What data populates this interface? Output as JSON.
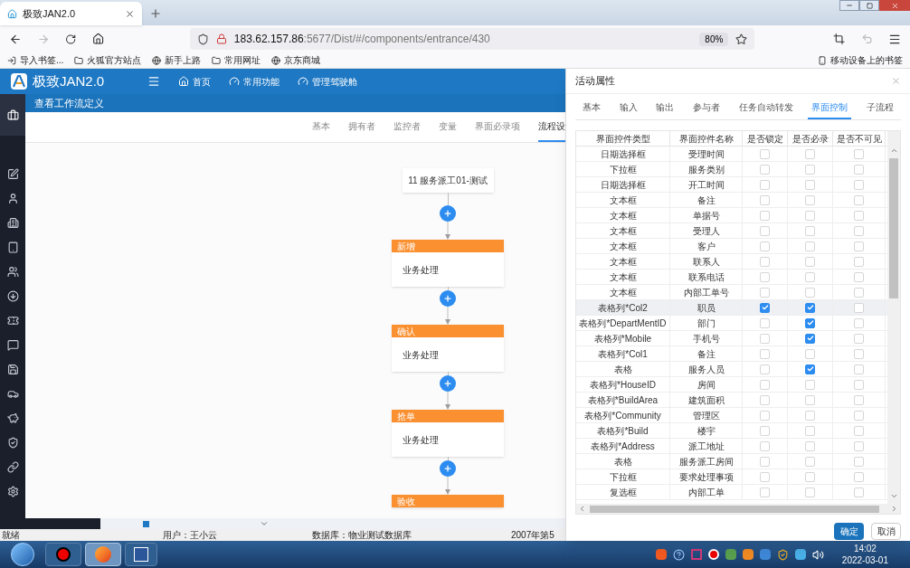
{
  "browser": {
    "tab_title": "极致JAN2.0",
    "url_host": "183.62.157.86",
    "url_path": ":5677/Dist/#/components/entrance/430",
    "zoom": "80%",
    "bookmarks": [
      "导入书签...",
      "火狐官方站点",
      "新手上路",
      "常用网址",
      "京东商城"
    ],
    "mobile_bookmarks": "移动设备上的书签"
  },
  "app": {
    "logo_text": "极致JAN2.0",
    "nav": [
      "首页",
      "常用功能",
      "管理驾驶舱"
    ]
  },
  "dialog": {
    "title": "查看工作流定义",
    "tabs": [
      {
        "label": "基本",
        "selected": false
      },
      {
        "label": "拥有者",
        "selected": false
      },
      {
        "label": "监控者",
        "selected": false
      },
      {
        "label": "变量",
        "selected": false
      },
      {
        "label": "界面必录项",
        "selected": false
      },
      {
        "label": "流程设",
        "selected": true
      }
    ],
    "start_node": "11 服务派工01-测试",
    "steps": [
      {
        "title": "新增",
        "body": "业务处理"
      },
      {
        "title": "确认",
        "body": "业务处理"
      },
      {
        "title": "抢单",
        "body": "业务处理"
      },
      {
        "title": "验收"
      }
    ]
  },
  "panel": {
    "title": "活动属性",
    "tabs": [
      {
        "label": "基本",
        "selected": false
      },
      {
        "label": "输入",
        "selected": false
      },
      {
        "label": "输出",
        "selected": false
      },
      {
        "label": "参与者",
        "selected": false
      },
      {
        "label": "任务自动转发",
        "selected": false
      },
      {
        "label": "界面控制",
        "selected": true
      },
      {
        "label": "子流程",
        "selected": false
      }
    ],
    "columns": [
      "界面控件类型",
      "界面控件名称",
      "是否锁定",
      "是否必录",
      "是否不可见"
    ],
    "rows": [
      {
        "type": "日期选择框",
        "name": "受理时间",
        "locked": false,
        "required": false,
        "hidden": false,
        "selected": false
      },
      {
        "type": "下拉框",
        "name": "服务类别",
        "locked": false,
        "required": false,
        "hidden": false,
        "selected": false
      },
      {
        "type": "日期选择框",
        "name": "开工时间",
        "locked": false,
        "required": false,
        "hidden": false,
        "selected": false
      },
      {
        "type": "文本框",
        "name": "备注",
        "locked": false,
        "required": false,
        "hidden": false,
        "selected": false
      },
      {
        "type": "文本框",
        "name": "单据号",
        "locked": false,
        "required": false,
        "hidden": false,
        "selected": false
      },
      {
        "type": "文本框",
        "name": "受理人",
        "locked": false,
        "required": false,
        "hidden": false,
        "selected": false
      },
      {
        "type": "文本框",
        "name": "客户",
        "locked": false,
        "required": false,
        "hidden": false,
        "selected": false
      },
      {
        "type": "文本框",
        "name": "联系人",
        "locked": false,
        "required": false,
        "hidden": false,
        "selected": false
      },
      {
        "type": "文本框",
        "name": "联系电话",
        "locked": false,
        "required": false,
        "hidden": false,
        "selected": false
      },
      {
        "type": "文本框",
        "name": "内部工单号",
        "locked": false,
        "required": false,
        "hidden": false,
        "selected": false
      },
      {
        "type": "表格列*Col2",
        "name": "职员",
        "locked": true,
        "required": true,
        "hidden": false,
        "selected": true
      },
      {
        "type": "表格列*DepartMentID",
        "name": "部门",
        "locked": false,
        "required": true,
        "hidden": false,
        "selected": false
      },
      {
        "type": "表格列*Mobile",
        "name": "手机号",
        "locked": false,
        "required": true,
        "hidden": false,
        "selected": false
      },
      {
        "type": "表格列*Col1",
        "name": "备注",
        "locked": false,
        "required": false,
        "hidden": false,
        "selected": false
      },
      {
        "type": "表格",
        "name": "服务人员",
        "locked": false,
        "required": true,
        "hidden": false,
        "selected": false
      },
      {
        "type": "表格列*HouseID",
        "name": "房间",
        "locked": false,
        "required": false,
        "hidden": false,
        "selected": false
      },
      {
        "type": "表格列*BuildArea",
        "name": "建筑面积",
        "locked": false,
        "required": false,
        "hidden": false,
        "selected": false
      },
      {
        "type": "表格列*Community",
        "name": "管理区",
        "locked": false,
        "required": false,
        "hidden": false,
        "selected": false
      },
      {
        "type": "表格列*Build",
        "name": "楼宇",
        "locked": false,
        "required": false,
        "hidden": false,
        "selected": false
      },
      {
        "type": "表格列*Address",
        "name": "派工地址",
        "locked": false,
        "required": false,
        "hidden": false,
        "selected": false
      },
      {
        "type": "表格",
        "name": "服务派工房间",
        "locked": false,
        "required": false,
        "hidden": false,
        "selected": false
      },
      {
        "type": "下拉框",
        "name": "要求处理事项",
        "locked": false,
        "required": false,
        "hidden": false,
        "selected": false
      },
      {
        "type": "复选框",
        "name": "内部工单",
        "locked": false,
        "required": false,
        "hidden": false,
        "selected": false
      }
    ],
    "buttons": [
      {
        "label": "确定",
        "kind": "primary"
      },
      {
        "label": "取消",
        "kind": "default"
      }
    ]
  },
  "status_bar": [
    "就绪",
    "用户：王小云",
    "数据库：物业测试数据库",
    "2007年第5"
  ],
  "taskbar": {
    "time": "14:02",
    "date": "2022-03-01"
  }
}
